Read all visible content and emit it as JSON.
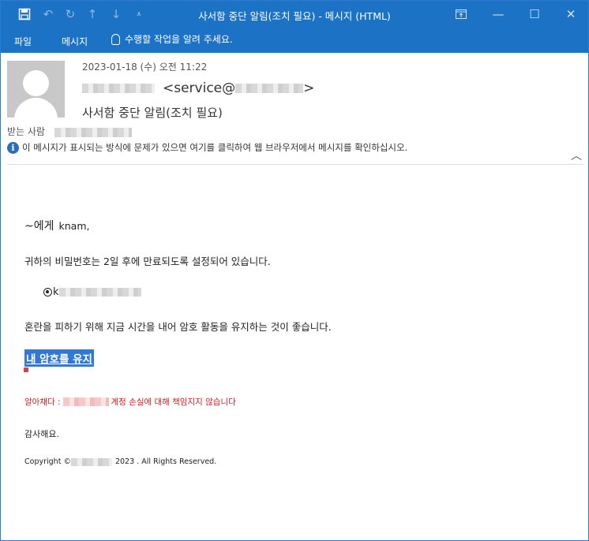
{
  "window": {
    "title": "사서함 중단 알림(조치 필요) - 메시지 (HTML)",
    "accent_color": "#1c72c4"
  },
  "quick_access": [
    {
      "icon": "save-icon"
    },
    {
      "icon": "undo-icon"
    },
    {
      "icon": "redo-icon"
    },
    {
      "icon": "up-arrow-icon"
    },
    {
      "icon": "down-arrow-icon"
    },
    {
      "icon": "customize-toolbar-icon"
    }
  ],
  "ribbon": {
    "tabs": [
      "파일",
      "메시지"
    ],
    "tell_me": "수행할 작업을 알려 주세요."
  },
  "header": {
    "date": "2023-01-18 (수) 오전 11:22",
    "from_address_prefix": "<service@",
    "from_address_suffix": ">",
    "subject": "사서함 중단 알림(조치 필요)",
    "to_label": "받는 사람",
    "info_bar": "이 메시지가 표시되는 방식에 문제가 있으면 여기를 클릭하여 웹 브라우저에서 메시지를 확인하십시오."
  },
  "body": {
    "greeting": "~에게",
    "recipient_name": "knam,",
    "line1": "귀하의 비밀번호는 2일 후에 만료되도록 설정되어 있습니다.",
    "account_prefix": "k",
    "line2": "혼란을 피하기 위해 지금 시간을 내어 암호 활동을 유지하는 것이 좋습니다.",
    "keep_password_link": "내 암호를 유지",
    "warning_prefix": "알아채다 :",
    "warning_suffix": "계정 손실에 대해 책임지지 않습니다",
    "thanks": "감사해요.",
    "copyright_prefix": "Copyright ©",
    "copyright_suffix": "2023 . All Rights Reserved.",
    "warning_color": "#d11c1c",
    "link_bg_color": "#3478d6"
  }
}
